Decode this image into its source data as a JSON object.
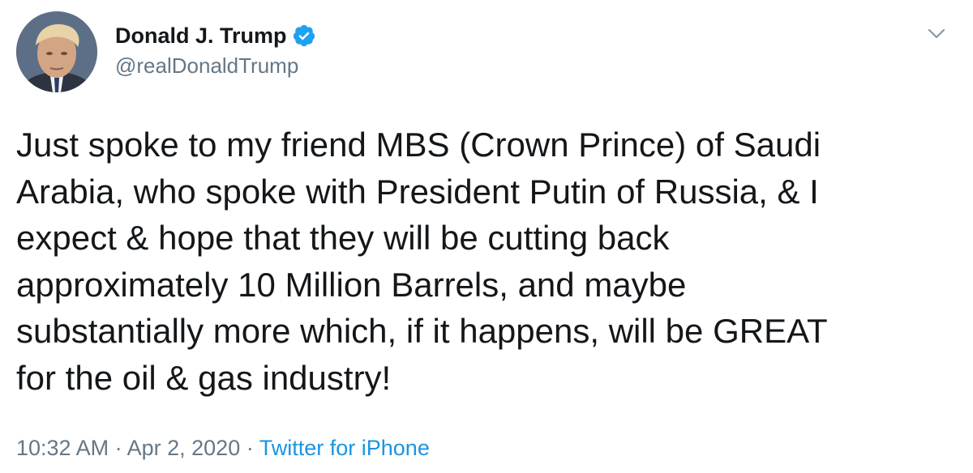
{
  "tweet": {
    "display_name": "Donald J. Trump",
    "handle": "@realDonaldTrump",
    "verified": true,
    "text": "Just spoke to my friend MBS (Crown Prince) of Saudi\nArabia, who spoke with President Putin of Russia, & I\nexpect & hope that they will be cutting back\napproximately 10 Million Barrels, and maybe\nsubstantially more which, if it happens, will be GREAT\nfor the oil & gas industry!",
    "time": "10:32 AM",
    "separator": "·",
    "date": "Apr 2, 2020",
    "source": "Twitter for iPhone"
  },
  "icons": {
    "verified": "verified-badge-icon",
    "menu": "chevron-down-icon"
  },
  "colors": {
    "text": "#14171a",
    "secondary": "#657786",
    "accent": "#1b95e0",
    "verified": "#1da1f2"
  }
}
